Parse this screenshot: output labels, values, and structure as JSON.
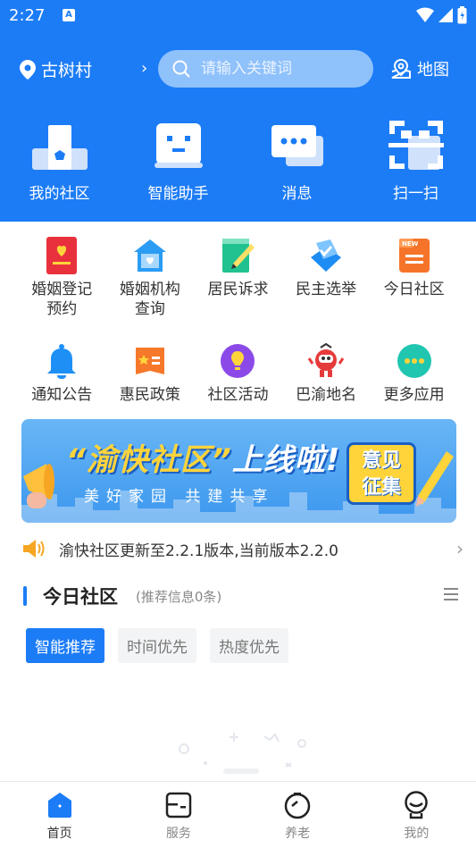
{
  "status_bar": {
    "time": "2:27",
    "badge": "A"
  },
  "header": {
    "location": "古树村",
    "search_placeholder": "请输入关键词",
    "map_label": "地图",
    "quick_actions": [
      {
        "label": "我的社区",
        "icon": "community-icon"
      },
      {
        "label": "智能助手",
        "icon": "robot-icon"
      },
      {
        "label": "消息",
        "icon": "message-icon"
      },
      {
        "label": "扫一扫",
        "icon": "scan-icon"
      }
    ]
  },
  "services": [
    {
      "label": "婚姻登记\n预约",
      "icon": "marriage-registration-icon",
      "color": "#e8313c"
    },
    {
      "label": "婚姻机构\n查询",
      "icon": "marriage-agency-icon",
      "color": "#2b9cf4"
    },
    {
      "label": "居民诉求",
      "icon": "resident-appeal-icon",
      "color": "#21c28f"
    },
    {
      "label": "民主选举",
      "icon": "election-icon",
      "color": "#1d8cf3"
    },
    {
      "label": "今日社区",
      "icon": "today-community-icon",
      "color": "#f5742a"
    },
    {
      "label": "通知公告",
      "icon": "bell-icon",
      "color": "#1e90f5"
    },
    {
      "label": "惠民政策",
      "icon": "policy-icon",
      "color": "#f6782b"
    },
    {
      "label": "社区活动",
      "icon": "activity-icon",
      "color": "#8b49e8"
    },
    {
      "label": "巴渝地名",
      "icon": "mascot-icon",
      "color": "#e63b3b"
    },
    {
      "label": "更多应用",
      "icon": "more-apps-icon",
      "color": "#20c6b0"
    }
  ],
  "banner": {
    "title_part1": "“渝快社区”",
    "title_part2": "上线啦!",
    "subtitle": "美好家园 共建共享",
    "button_text": "意见\n征集"
  },
  "notice": {
    "text": "渝快社区更新至2.2.1版本,当前版本2.2.0"
  },
  "today": {
    "title": "今日社区",
    "subtitle": "(推荐信息0条)",
    "tabs": [
      "智能推荐",
      "时间优先",
      "热度优先"
    ]
  },
  "bottom_nav": [
    {
      "label": "首页",
      "icon": "home-icon",
      "active": true
    },
    {
      "label": "服务",
      "icon": "service-icon",
      "active": false
    },
    {
      "label": "养老",
      "icon": "elderly-care-icon",
      "active": false
    },
    {
      "label": "我的",
      "icon": "profile-icon",
      "active": false
    }
  ],
  "colors": {
    "primary": "#1c7cf6",
    "search_bg": "#8fc1fb",
    "banner_yellow": "#ffd43b"
  }
}
